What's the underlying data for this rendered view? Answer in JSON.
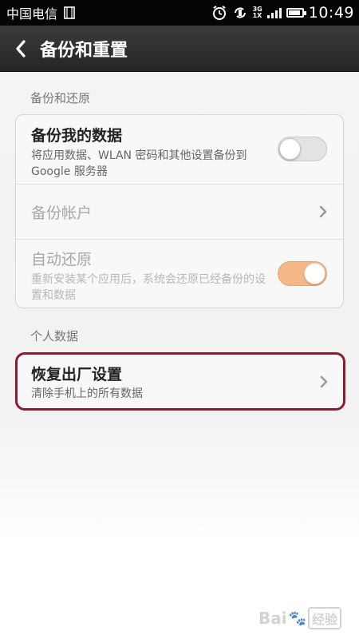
{
  "status_bar": {
    "carrier": "中国电信",
    "network_top": "3G",
    "network_bottom": "1X",
    "time": "10:49"
  },
  "header": {
    "title": "备份和重置"
  },
  "sections": {
    "backup_header": "备份和还原",
    "personal_header": "个人数据"
  },
  "backup_card": {
    "backup_data_title": "备份我的数据",
    "backup_data_sub": "将应用数据、WLAN 密码和其他设置备份到 Google 服务器",
    "backup_data_on": false,
    "backup_account_title": "备份帐户",
    "auto_restore_title": "自动还原",
    "auto_restore_sub": "重新安装某个应用后，系统会还原已经备份的设置和数据",
    "auto_restore_on": true
  },
  "personal_card": {
    "factory_reset_title": "恢复出厂设置",
    "factory_reset_sub": "清除手机上的所有数据"
  },
  "watermark": {
    "brand": "Bai",
    "suffix": "经验"
  },
  "colors": {
    "highlight_border": "#8a1c2e",
    "toggle_on": "#f3b888"
  }
}
